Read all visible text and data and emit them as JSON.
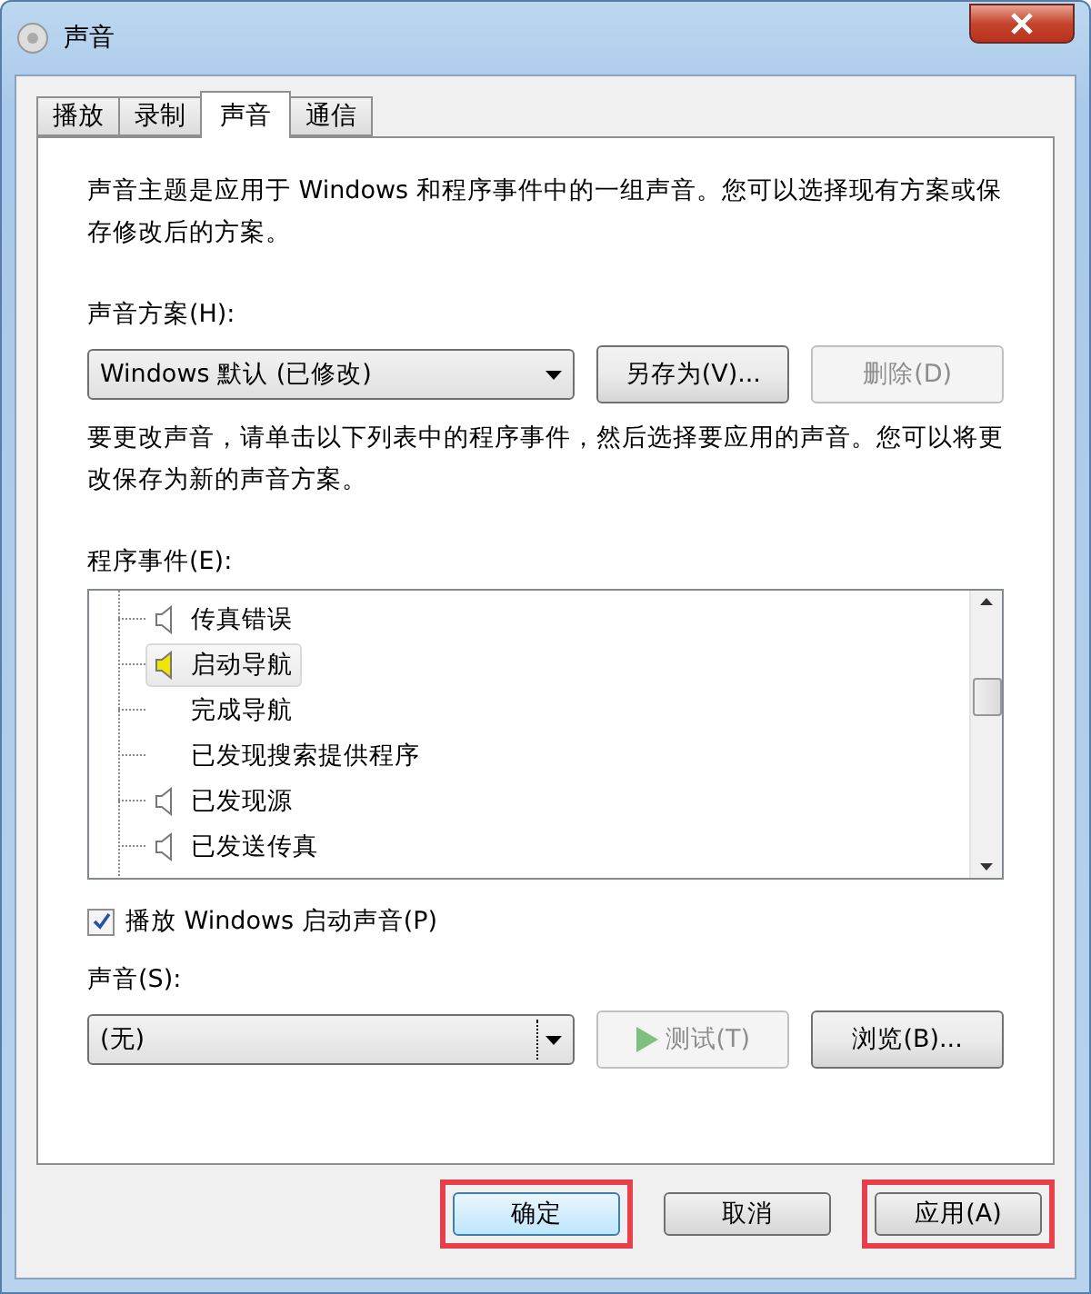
{
  "window": {
    "title": "声音"
  },
  "tabs": [
    {
      "label": "播放",
      "selected": false
    },
    {
      "label": "录制",
      "selected": false
    },
    {
      "label": "声音",
      "selected": true
    },
    {
      "label": "通信",
      "selected": false
    }
  ],
  "intro": "声音主题是应用于 Windows 和程序事件中的一组声音。您可以选择现有方案或保存修改后的方案。",
  "scheme": {
    "label": "声音方案(H):",
    "value": "Windows 默认 (已修改)",
    "buttons": [
      {
        "label": "另存为(V)...",
        "disabled": false
      },
      {
        "label": "删除(D)",
        "disabled": true
      }
    ]
  },
  "hint": "要更改声音，请单击以下列表中的程序事件，然后选择要应用的声音。您可以将更改保存为新的声音方案。",
  "events": {
    "label": "程序事件(E):",
    "items": [
      {
        "label": "传真错误",
        "has_sound": true,
        "selected": false
      },
      {
        "label": "启动导航",
        "has_sound": true,
        "selected": true
      },
      {
        "label": "完成导航",
        "has_sound": false,
        "selected": false
      },
      {
        "label": "已发现搜索提供程序",
        "has_sound": false,
        "selected": false
      },
      {
        "label": "已发现源",
        "has_sound": true,
        "selected": false
      },
      {
        "label": "已发送传真",
        "has_sound": true,
        "selected": false
      }
    ]
  },
  "startup": {
    "label": "播放 Windows 启动声音(P)",
    "checked": true
  },
  "sound": {
    "label": "声音(S):",
    "value": "(无)",
    "test": {
      "label": "测试(T)",
      "disabled": true
    },
    "browse": {
      "label": "浏览(B)...",
      "disabled": false
    }
  },
  "footer": [
    {
      "label": "确定",
      "highlighted": true,
      "default": true
    },
    {
      "label": "取消",
      "highlighted": false,
      "default": false
    },
    {
      "label": "应用(A)",
      "highlighted": true,
      "default": false
    }
  ]
}
